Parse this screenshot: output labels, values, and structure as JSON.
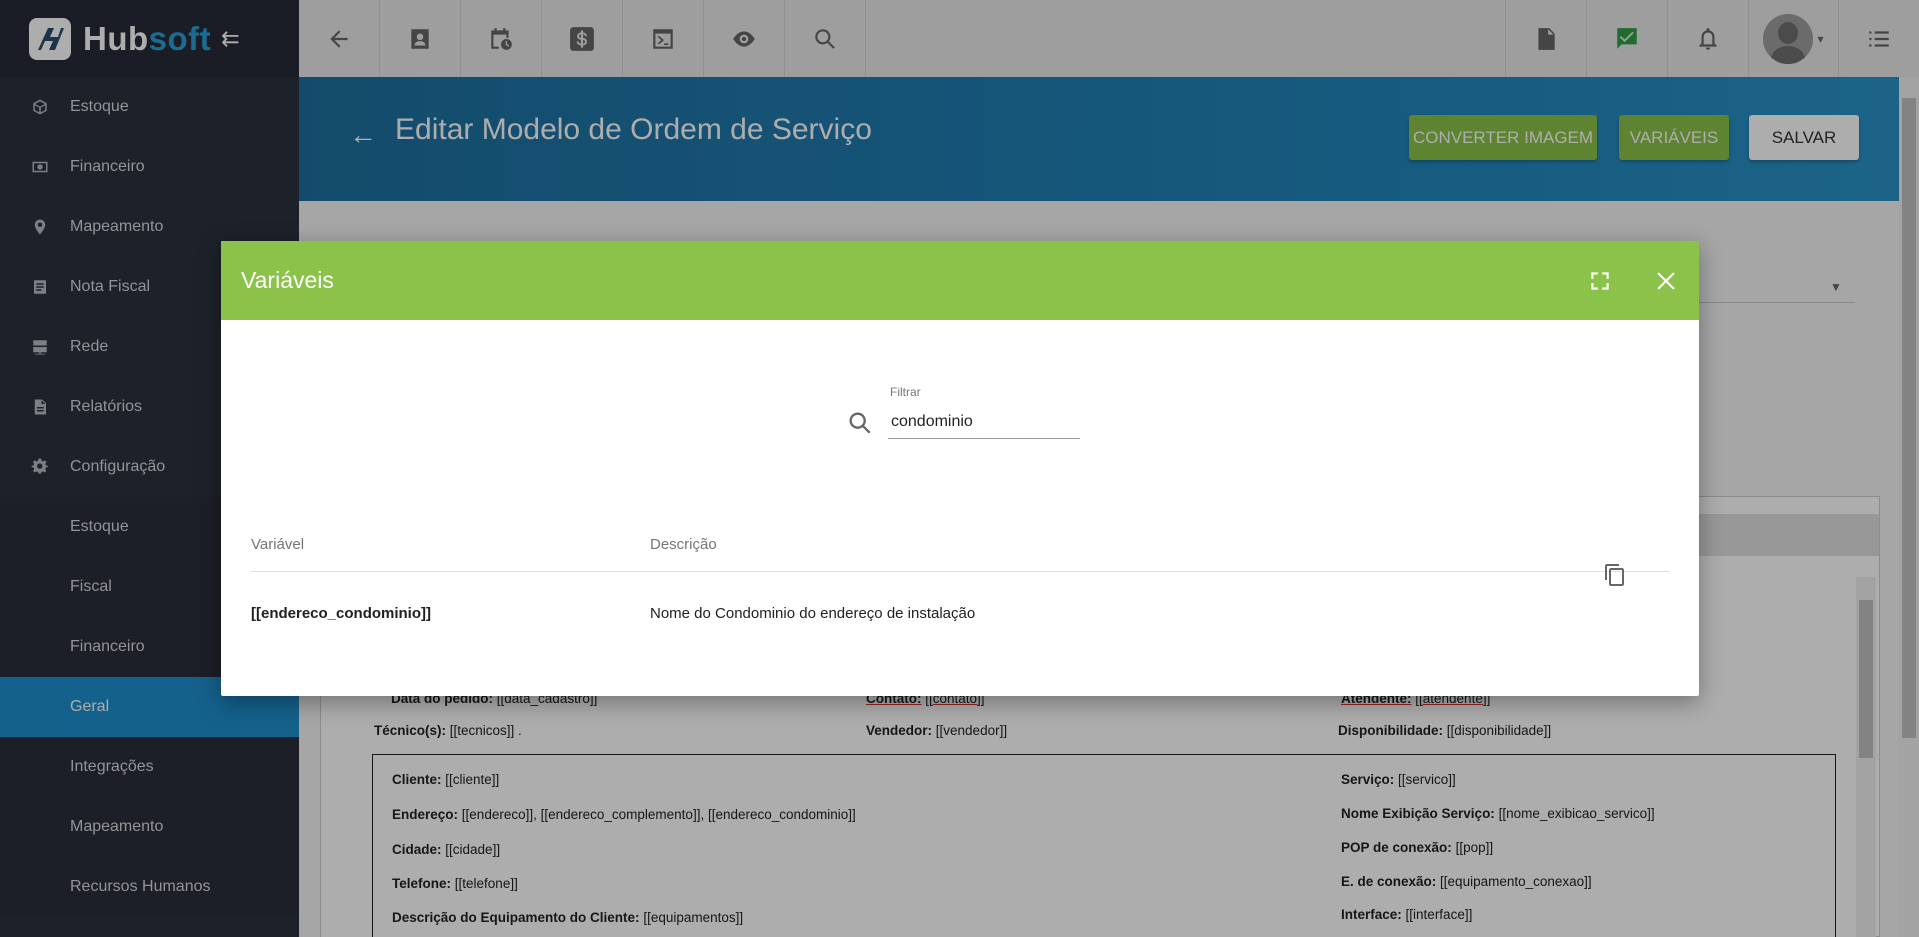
{
  "brand": {
    "part1": "Hub",
    "part2": "soft"
  },
  "sidebar": {
    "items": [
      {
        "label": "Estoque",
        "icon": "cube-icon"
      },
      {
        "label": "Financeiro",
        "icon": "money-icon"
      },
      {
        "label": "Mapeamento",
        "icon": "map-pin-icon"
      },
      {
        "label": "Nota Fiscal",
        "icon": "receipt-icon"
      },
      {
        "label": "Rede",
        "icon": "server-icon"
      },
      {
        "label": "Relatórios",
        "icon": "document-icon"
      },
      {
        "label": "Configuração",
        "icon": "gear-icon"
      }
    ],
    "sub_items": [
      {
        "label": "Estoque"
      },
      {
        "label": "Fiscal"
      },
      {
        "label": "Financeiro"
      },
      {
        "label": "Geral",
        "active": true
      },
      {
        "label": "Integrações"
      },
      {
        "label": "Mapeamento"
      },
      {
        "label": "Recursos Humanos"
      }
    ]
  },
  "header": {
    "title": "Editar Modelo de Ordem de Serviço",
    "btn_convert": "CONVERTER IMAGEM",
    "btn_variables": "VARIÁVEIS",
    "btn_save": "SALVAR"
  },
  "editor": {
    "row1": {
      "c1_label": "Data do pedido:",
      "c1_value": "[[data_cadastro]]",
      "c2_label": "Contato:",
      "c2_value": "[[contato]]",
      "c3_label": "Atendente:",
      "c3_value": "[[atendente]]"
    },
    "row2": {
      "c1_label": "Técnico(s):",
      "c1_value": "[[tecnicos]] .",
      "c2_label": "Vendedor:",
      "c2_value": "[[vendedor]]",
      "c3_label": "Disponibilidade:",
      "c3_value": "[[disponibilidade]]"
    },
    "left_lines": [
      {
        "label": "Cliente:",
        "value": "[[cliente]]"
      },
      {
        "label": "Endereço:",
        "value": "[[endereco]], [[endereco_complemento]], [[endereco_condominio]]"
      },
      {
        "label": "Cidade:",
        "value": "[[cidade]]"
      },
      {
        "label": "Telefone:",
        "value": "[[telefone]]"
      },
      {
        "label": "Descrição do Equipamento do Cliente:",
        "value": "[[equipamentos]]"
      }
    ],
    "right_lines": [
      {
        "label": "Serviço:",
        "value": "[[servico]]"
      },
      {
        "label": "Nome Exibição Serviço:",
        "value": "[[nome_exibicao_servico]]"
      },
      {
        "label": "POP de conexão:",
        "value": "[[pop]]"
      },
      {
        "label": "E. de conexão:",
        "value": "[[equipamento_conexao]]"
      },
      {
        "label": "Interface:",
        "value": "[[interface]]"
      }
    ]
  },
  "modal": {
    "title": "Variáveis",
    "filter_label": "Filtrar",
    "filter_value": "condominio",
    "columns": {
      "variable": "Variável",
      "description": "Descrição"
    },
    "rows": [
      {
        "variable": "[[endereco_condominio]]",
        "description": "Nome do Condominio do endereço de instalação"
      }
    ]
  },
  "colors": {
    "accent_green": "#8bc34a",
    "accent_blue": "#1e8fce",
    "sidebar_bg": "#2c313d"
  }
}
